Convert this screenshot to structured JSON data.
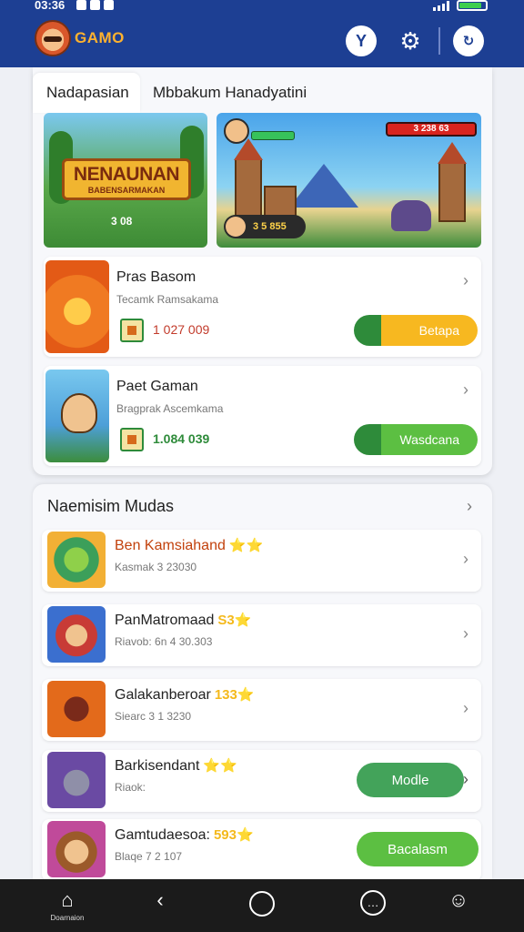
{
  "status": {
    "time": "03:36"
  },
  "header": {
    "logo_text": "GAMO",
    "btn1": "Y",
    "btn2": "⚙",
    "btn3": "↻"
  },
  "tabs": [
    {
      "label": "Nadapasian"
    },
    {
      "label": "Mbbakum Hanadyatini"
    }
  ],
  "banners": [
    {
      "title": "NENAUNAN",
      "subtitle": "BABENSARMAKAN",
      "score": "3 08"
    },
    {
      "health_text": "3 238 63",
      "bot_text": "3 5 855"
    }
  ],
  "featured_games": [
    {
      "title": "Pras Basom",
      "subtitle": "Tecamk Ramsakama",
      "number": "1 027 009",
      "button": "Betapa"
    },
    {
      "title": "Paet Gaman",
      "subtitle": "Bragprak Ascemkama",
      "number": "1.084 039",
      "button": "Wasdcana"
    }
  ],
  "more": {
    "title": "Naemisim Mudas",
    "items": [
      {
        "title": "Ben Kamsiahand",
        "stars": "⭐⭐",
        "subtitle": "Kasmak 3 23030",
        "color": "#3c9f5a"
      },
      {
        "title": "PanMatromaad",
        "stars": "S3⭐",
        "subtitle": "Riavob: 6n 4 30.303",
        "color": "#c83b36"
      },
      {
        "title": "Galakanberoar",
        "stars": "133⭐",
        "subtitle": "Siearc 3 1 3230",
        "color": "#e36a1b"
      },
      {
        "title": "Barkisendant",
        "stars": "⭐⭐",
        "subtitle": "Riaok:",
        "color": "#6a4aa3",
        "button": "Modle"
      },
      {
        "title": "Gamtudaesoa:",
        "stars": "593⭐",
        "subtitle": "Blaqe 7 2 107",
        "color": "#c04a9a",
        "button": "Bacalasm"
      }
    ]
  },
  "nav": {
    "home_label": "Doarnaion"
  }
}
